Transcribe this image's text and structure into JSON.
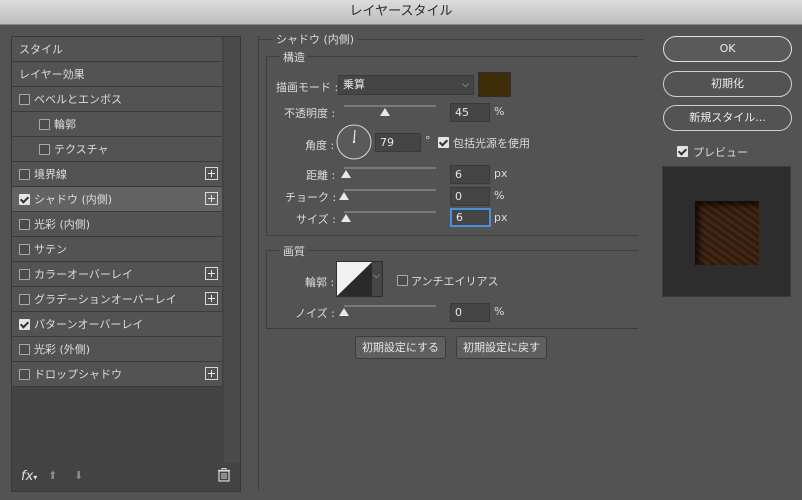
{
  "window": {
    "title": "レイヤースタイル"
  },
  "sidebar": {
    "items": [
      {
        "label": "スタイル",
        "checkbox": false,
        "checked": false,
        "plus": false,
        "indent": 0
      },
      {
        "label": "レイヤー効果",
        "checkbox": false,
        "checked": false,
        "plus": false,
        "indent": 0
      },
      {
        "label": "ベベルとエンボス",
        "checkbox": true,
        "checked": false,
        "plus": false,
        "indent": 0
      },
      {
        "label": "輪郭",
        "checkbox": true,
        "checked": false,
        "plus": false,
        "indent": 1
      },
      {
        "label": "テクスチャ",
        "checkbox": true,
        "checked": false,
        "plus": false,
        "indent": 1
      },
      {
        "label": "境界線",
        "checkbox": true,
        "checked": false,
        "plus": true,
        "indent": 0
      },
      {
        "label": "シャドウ (内側)",
        "checkbox": true,
        "checked": true,
        "plus": true,
        "indent": 0,
        "selected": true
      },
      {
        "label": "光彩 (内側)",
        "checkbox": true,
        "checked": false,
        "plus": false,
        "indent": 0
      },
      {
        "label": "サテン",
        "checkbox": true,
        "checked": false,
        "plus": false,
        "indent": 0
      },
      {
        "label": "カラーオーバーレイ",
        "checkbox": true,
        "checked": false,
        "plus": true,
        "indent": 0
      },
      {
        "label": "グラデーションオーバーレイ",
        "checkbox": true,
        "checked": false,
        "plus": true,
        "indent": 0
      },
      {
        "label": "パターンオーバーレイ",
        "checkbox": true,
        "checked": true,
        "plus": false,
        "indent": 0
      },
      {
        "label": "光彩 (外側)",
        "checkbox": true,
        "checked": false,
        "plus": false,
        "indent": 0
      },
      {
        "label": "ドロップシャドウ",
        "checkbox": true,
        "checked": false,
        "plus": true,
        "indent": 0
      }
    ],
    "fx_label": "fx"
  },
  "main": {
    "section_title": "シャドウ (内側)",
    "structure": {
      "legend": "構造",
      "blend_mode": {
        "label": "描画モード :",
        "value": "乗算",
        "color": "#3f2d0a"
      },
      "opacity": {
        "label": "不透明度 :",
        "value": "45",
        "unit": "%",
        "fraction": 0.45
      },
      "angle": {
        "label": "角度 :",
        "value": "79",
        "unit": "°",
        "global_light_label": "包括光源を使用",
        "global_light": true
      },
      "distance": {
        "label": "距離 :",
        "value": "6",
        "unit": "px",
        "fraction": 0.02
      },
      "choke": {
        "label": "チョーク :",
        "value": "0",
        "unit": "%",
        "fraction": 0.0
      },
      "size": {
        "label": "サイズ :",
        "value": "6",
        "unit": "px",
        "fraction": 0.02
      }
    },
    "quality": {
      "legend": "画質",
      "contour_label": "輪郭 :",
      "antialias_label": "アンチエイリアス",
      "antialias": false,
      "noise": {
        "label": "ノイズ :",
        "value": "0",
        "unit": "%",
        "fraction": 0.0
      }
    },
    "buttons": {
      "make_default": "初期設定にする",
      "reset_default": "初期設定に戻す"
    }
  },
  "right": {
    "ok": "OK",
    "reset": "初期化",
    "new_style": "新規スタイル...",
    "preview_label": "プレビュー",
    "preview": true
  }
}
